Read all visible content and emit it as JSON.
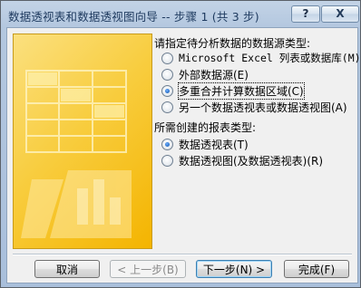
{
  "dialog": {
    "title": "数据透视表和数据透视图向导 -- 步骤 1 (共 3 步)",
    "help_label": "?",
    "close_label": "X"
  },
  "source_group": {
    "label": "请指定待分析数据的数据源类型:",
    "options": [
      {
        "text": "Microsoft Excel 列表或数据库(M)",
        "checked": false
      },
      {
        "text": "外部数据源(E)",
        "checked": false
      },
      {
        "text": "多重合并计算数据区域(C)",
        "checked": true
      },
      {
        "text": "另一个数据透视表或数据透视图(A)",
        "checked": false
      }
    ]
  },
  "report_group": {
    "label": "所需创建的报表类型:",
    "options": [
      {
        "text": "数据透视表(T)",
        "checked": true
      },
      {
        "text": "数据透视图(及数据透视表)(R)",
        "checked": false
      }
    ]
  },
  "buttons": {
    "cancel": "取消",
    "back": "< 上一步(B)",
    "next": "下一步(N) >",
    "finish": "完成(F)"
  },
  "colors": {
    "accent": "#f4b400",
    "title_text": "#1e3a5f",
    "frame": "#b3c7df"
  }
}
